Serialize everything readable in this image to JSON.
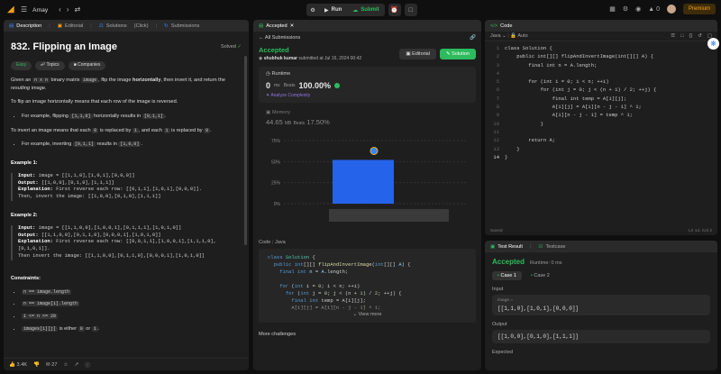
{
  "topbar": {
    "user": "Arnay",
    "run": "Run",
    "submit": "Submit",
    "streak": "0",
    "premium": "Premium"
  },
  "left": {
    "tabs": {
      "description": "Description",
      "editorial": "Editorial",
      "solutions": "Solutions",
      "click": "(Click)",
      "submissions": "Submissions"
    },
    "title": "832. Flipping an Image",
    "solved": "Solved",
    "tags": {
      "easy": "Easy",
      "topics": "Topics",
      "companies": "Companies"
    },
    "p1a": "Given an ",
    "p1code": "n x n",
    "p1b": " binary matrix ",
    "p1code2": "image",
    "p1c": ", flip the image ",
    "p1bold": "horizontally",
    "p1d": ", then invert it, and return the ",
    "p1i": "resulting image",
    "p1e": ".",
    "p2": "To flip an image horizontally means that each row of the image is reversed.",
    "li1a": "For example, flipping ",
    "li1c1": "[1,1,0]",
    "li1b": " horizontally results in ",
    "li1c2": "[0,1,1]",
    "li1d": ".",
    "p3a": "To invert an image means that each ",
    "p3c1": "0",
    "p3b": " is replaced by ",
    "p3c2": "1",
    "p3c": ", and each ",
    "p3c3": "1",
    "p3d": " is replaced by ",
    "p3c4": "0",
    "p3e": ".",
    "li2a": "For example, inverting ",
    "li2c1": "[0,1,1]",
    "li2b": " results in ",
    "li2c2": "[1,0,0]",
    "li2d": ".",
    "ex1h": "Example 1:",
    "ex1in": "image = [[1,1,0],[1,0,1],[0,0,0]]",
    "ex1out": "[[1,0,0],[0,1,0],[1,1,1]]",
    "ex1exp": "First reverse each row: [[0,1,1],[1,0,1],[0,0,0]].\nThen, invert the image: [[1,0,0],[0,1,0],[1,1,1]]",
    "ex2h": "Example 2:",
    "ex2in": "image = [[1,1,0,0],[1,0,0,1],[0,1,1,1],[1,0,1,0]]",
    "ex2out": "[[1,1,0,0],[0,1,1,0],[0,0,0,1],[1,0,1,0]]",
    "ex2exp": "First reverse each row: [[0,0,1,1],[1,0,0,1],[1,1,1,0],[0,1,0,1]].\nThen invert the image: [[1,1,0,0],[0,1,1,0],[0,0,0,1],[1,0,1,0]]",
    "lab_input": "Input:",
    "lab_output": "Output:",
    "lab_exp": "Explanation:",
    "consh": "Constraints:",
    "c1": "n == image.length",
    "c2": "n == image[i].length",
    "c3": "1 <= n <= 20",
    "c4a": "images[i][j]",
    "c4b": " is either ",
    "c4c": "0",
    "c4d": " or ",
    "c4e": "1",
    "c4f": ".",
    "likes": "3.4K",
    "comments": "27"
  },
  "mid": {
    "tab": "Accepted",
    "back": "All Submissions",
    "status": "Accepted",
    "user": "shubhuk kumar",
    "submitted": "submitted at Jul 16, 2024 00:42",
    "editorial": "Editorial",
    "solution": "Solution",
    "runtime_label": "Runtime",
    "runtime": "0",
    "runtime_unit": "ms",
    "beats_label": "Beats",
    "runtime_beats": "100.00%",
    "analyze": "Analyze Complexity",
    "memory_label": "Memory",
    "memory": "44.65",
    "memory_unit": "MB",
    "memory_beats": "17.50%",
    "code_label": "Code",
    "lang": "Java",
    "view_more": "View more",
    "more": "More challenges"
  },
  "chart_data": {
    "type": "bar",
    "y_ticks": [
      "75%",
      "50%",
      "25%",
      "0%"
    ],
    "ylim": [
      0,
      75
    ],
    "bars": [
      {
        "value": 52
      }
    ]
  },
  "code": {
    "tab": "Code",
    "lang": "Java",
    "mode": "Auto",
    "saved": "Saved",
    "pos": "Ln 14, Col 2",
    "lines": [
      "class Solution {",
      "    public int[][] flipAndInvertImage(int[][] A) {",
      "        final int n = A.length;",
      "",
      "        for (int i = 0; i < n; ++i)",
      "            for (int j = 0; j < (n + 1) / 2; ++j) {",
      "                final int temp = A[i][j];",
      "                A[i][j] = A[i][n - j - 1] ^ 1;",
      "                A[i][n - j - 1] = temp ^ 1;",
      "            }",
      "",
      "        return A;",
      "    }",
      "}"
    ]
  },
  "result": {
    "tab1": "Test Result",
    "tab2": "Testcase",
    "status": "Accepted",
    "runtime": "Runtime: 0 ms",
    "case1": "Case 1",
    "case2": "Case 2",
    "input_label": "Input",
    "input_key": "image =",
    "input_val": "[[1,1,0],[1,0,1],[0,0,0]]",
    "output_label": "Output",
    "output_val": "[[1,0,0],[0,1,0],[1,1,1]]",
    "expected": "Expected"
  }
}
